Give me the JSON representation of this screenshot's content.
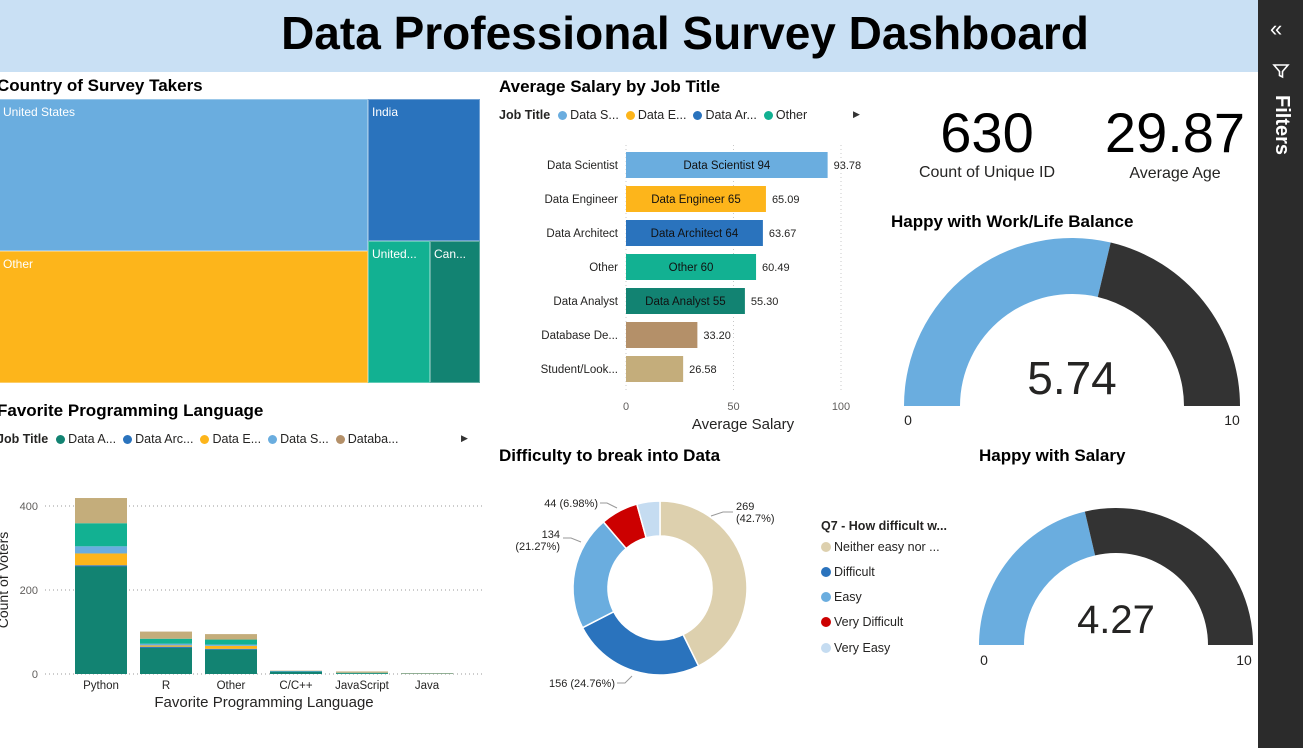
{
  "title": "Data Professional Survey Dashboard",
  "filters_label": "Filters",
  "icons": {
    "collapse": "double-chevron-left-icon",
    "filter": "funnel-icon"
  },
  "colors": {
    "teal_dark": "#128372",
    "blue": "#2a73bd",
    "yellow": "#fdb51b",
    "light_blue": "#6aaddf",
    "tan": "#b49069",
    "beige": "#c4ad7b",
    "teal": "#12b192",
    "red": "#cc0000",
    "dark": "#333333",
    "pale": "#c5dcf1",
    "donut_beige": "#ddd0ae"
  },
  "treemap": {
    "title": "Country of Survey Takers",
    "cells": [
      {
        "label": "United States",
        "color": "#6aaddf"
      },
      {
        "label": "India",
        "color": "#2a73bd"
      },
      {
        "label": "Other",
        "color": "#fdb51b"
      },
      {
        "label": "United...",
        "color": "#12b192"
      },
      {
        "label": "Can...",
        "color": "#128372"
      }
    ]
  },
  "salary": {
    "title": "Average Salary by Job Title",
    "legend_title": "Job Title",
    "legend": [
      {
        "label": "Data S...",
        "color": "#6aaddf"
      },
      {
        "label": "Data E...",
        "color": "#fdb51b"
      },
      {
        "label": "Data Ar...",
        "color": "#2a73bd"
      },
      {
        "label": "Other",
        "color": "#12b192"
      }
    ],
    "xlabel": "Average Salary",
    "xticks": [
      "0",
      "50",
      "100"
    ]
  },
  "kpis": [
    {
      "value": "630",
      "label": "Count of Unique ID"
    },
    {
      "value": "29.87",
      "label": "Average Age"
    }
  ],
  "gauges": [
    {
      "title": "Happy with Work/Life Balance",
      "value": 5.74,
      "value_text": "5.74",
      "min": 0,
      "max": 10,
      "min_text": "0",
      "max_text": "10"
    },
    {
      "title": "Happy with Salary",
      "value": 4.27,
      "value_text": "4.27",
      "min": 0,
      "max": 10,
      "min_text": "0",
      "max_text": "10"
    }
  ],
  "lang": {
    "title": "Favorite Programming Language",
    "legend_title": "Job Title",
    "legend": [
      {
        "label": "Data A...",
        "color": "#128372"
      },
      {
        "label": "Data Arc...",
        "color": "#2a73bd"
      },
      {
        "label": "Data E...",
        "color": "#fdb51b"
      },
      {
        "label": "Data S...",
        "color": "#6aaddf"
      },
      {
        "label": "Databa...",
        "color": "#b49069"
      }
    ],
    "xlabel": "Favorite Programming Language",
    "ylabel": "Count of Voters",
    "yticks": [
      "0",
      "200",
      "400"
    ]
  },
  "donut": {
    "title": "Difficulty to break into Data",
    "legend_title": "Q7 - How difficult w...",
    "legend": [
      {
        "label": "Neither easy nor ...",
        "color": "#ddd0ae"
      },
      {
        "label": "Difficult",
        "color": "#2a73bd"
      },
      {
        "label": "Easy",
        "color": "#6aaddf"
      },
      {
        "label": "Very Difficult",
        "color": "#cc0000"
      },
      {
        "label": "Very Easy",
        "color": "#c5dcf1"
      }
    ]
  },
  "chart_data": [
    {
      "type": "treemap",
      "title": "Country of Survey Takers",
      "categories": [
        "United States",
        "India",
        "Other",
        "United...",
        "Can..."
      ]
    },
    {
      "type": "bar",
      "orientation": "horizontal",
      "title": "Average Salary by Job Title",
      "categories": [
        "Data Scientist",
        "Data Engineer",
        "Data Architect",
        "Other",
        "Data Analyst",
        "Database De...",
        "Student/Look..."
      ],
      "values": [
        93.78,
        65.09,
        63.67,
        60.49,
        55.3,
        33.2,
        26.58
      ],
      "value_labels": [
        "93.78",
        "65.09",
        "63.67",
        "60.49",
        "55.30",
        "33.20",
        "26.58"
      ],
      "inner_labels": [
        "Data Scientist 94",
        "Data Engineer 65",
        "Data Architect 64",
        "Other 60",
        "Data Analyst 55",
        "",
        ""
      ],
      "colors": [
        "#6aaddf",
        "#fdb51b",
        "#2a73bd",
        "#12b192",
        "#128372",
        "#b49069",
        "#c4ad7b"
      ],
      "xlabel": "Average Salary",
      "xlim": [
        0,
        108
      ],
      "grid": true
    },
    {
      "type": "bar",
      "stacked": true,
      "title": "Favorite Programming Language",
      "categories": [
        "Python",
        "R",
        "Other",
        "C/C++",
        "JavaScript",
        "Java"
      ],
      "series": [
        {
          "name": "Data A...",
          "color": "#128372",
          "values": [
            256,
            62,
            58,
            5,
            2,
            1
          ]
        },
        {
          "name": "Data Arc...",
          "color": "#2a73bd",
          "values": [
            3,
            3,
            2,
            1,
            0,
            0
          ]
        },
        {
          "name": "Data E...",
          "color": "#fdb51b",
          "values": [
            28,
            3,
            7,
            0,
            0,
            0
          ]
        },
        {
          "name": "Data S...",
          "color": "#6aaddf",
          "values": [
            17,
            4,
            3,
            0,
            0,
            0
          ]
        },
        {
          "name": "",
          "color": "#12b192",
          "values": [
            55,
            12,
            12,
            1,
            1,
            0
          ]
        },
        {
          "name": "Databa...",
          "color": "#b49069",
          "values": [
            0,
            0,
            0,
            0,
            0,
            0
          ]
        },
        {
          "name": "",
          "color": "#c4ad7b",
          "values": [
            60,
            17,
            13,
            1,
            3,
            1
          ]
        }
      ],
      "xlabel": "Favorite Programming Language",
      "ylabel": "Count of Voters",
      "ylim": [
        0,
        440
      ],
      "grid": true
    },
    {
      "type": "pie",
      "donut": true,
      "title": "Difficulty to break into Data",
      "categories": [
        "Neither easy nor ...",
        "Difficult",
        "Easy",
        "Very Difficult",
        "Very Easy"
      ],
      "values": [
        269,
        156,
        134,
        44,
        27
      ],
      "percent_labels": [
        "269\n(42.7%)",
        "156 (24.76%)",
        "134\n(21.27%)",
        "44 (6.98%)",
        ""
      ],
      "colors": [
        "#ddd0ae",
        "#2a73bd",
        "#6aaddf",
        "#cc0000",
        "#c5dcf1"
      ]
    }
  ]
}
